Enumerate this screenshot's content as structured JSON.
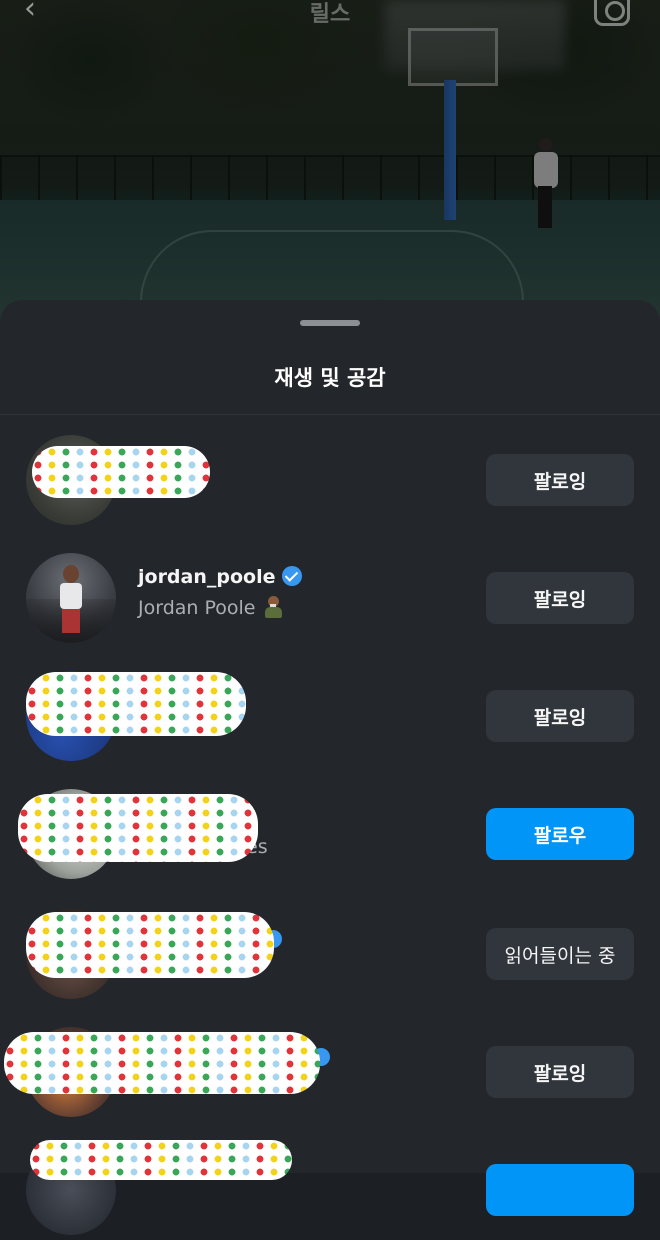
{
  "topbar": {
    "title": "릴스"
  },
  "sheet": {
    "title": "재생 및 공감"
  },
  "rows": [
    {
      "name": "",
      "subname": "",
      "button": "팔로잉",
      "button_style": "secondary"
    },
    {
      "name": "jordan_poole",
      "subname": "Jordan Poole",
      "verified": true,
      "button": "팔로잉",
      "button_style": "secondary"
    },
    {
      "name": "",
      "subname": "",
      "button": "팔로잉",
      "button_style": "secondary"
    },
    {
      "name": "",
      "subname": "es",
      "button": "팔로우",
      "button_style": "primary"
    },
    {
      "name": "",
      "subname": "",
      "verified": true,
      "button": "읽어들이는 중",
      "button_style": "secondary"
    },
    {
      "name": "",
      "subname": "",
      "verified": true,
      "button": "팔로잉",
      "button_style": "secondary"
    },
    {
      "name": "",
      "subname": "",
      "button": "",
      "button_style": "primary"
    }
  ],
  "colors": {
    "primary": "#0095f6",
    "secondary_button": "#31363c",
    "sheet_bg": "#23272b",
    "verified": "#3897f0"
  },
  "icons": {
    "back": "chevron-left-icon",
    "camera": "camera-icon",
    "verified": "verified-badge-icon"
  }
}
